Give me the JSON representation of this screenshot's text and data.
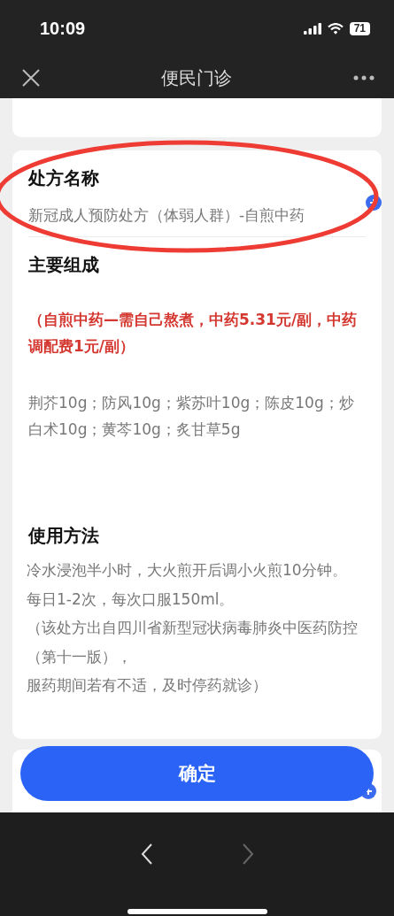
{
  "status_bar": {
    "time": "10:09",
    "battery": "71"
  },
  "nav": {
    "title": "便民门诊"
  },
  "prescription": {
    "name_label": "处方名称",
    "name_value": "新冠成人预防处方（体弱人群）-自煎中药",
    "composition_label": "主要组成",
    "price_note": "（自煎中药—需自己熬煮，中药5.31元/副，中药调配费1元/副）",
    "ingredients": "荆芥10g；防风10g；紫苏叶10g；陈皮10g；炒白术10g；黄芩10g；炙甘草5g",
    "usage_label": "使用方法",
    "usage_lines": [
      "冷水浸泡半小时，大火煎开后调小火煎10分钟。",
      "每日1-2次，每次口服150ml。",
      "（该处方出自四川省新型冠状病毒肺炎中医药防控",
      "（第十一版），",
      "服药期间若有不适，及时停药就诊）"
    ]
  },
  "confirm_button": "确定",
  "toolbar": {
    "back": {
      "disabled": false
    },
    "forward": {
      "disabled": true
    }
  }
}
